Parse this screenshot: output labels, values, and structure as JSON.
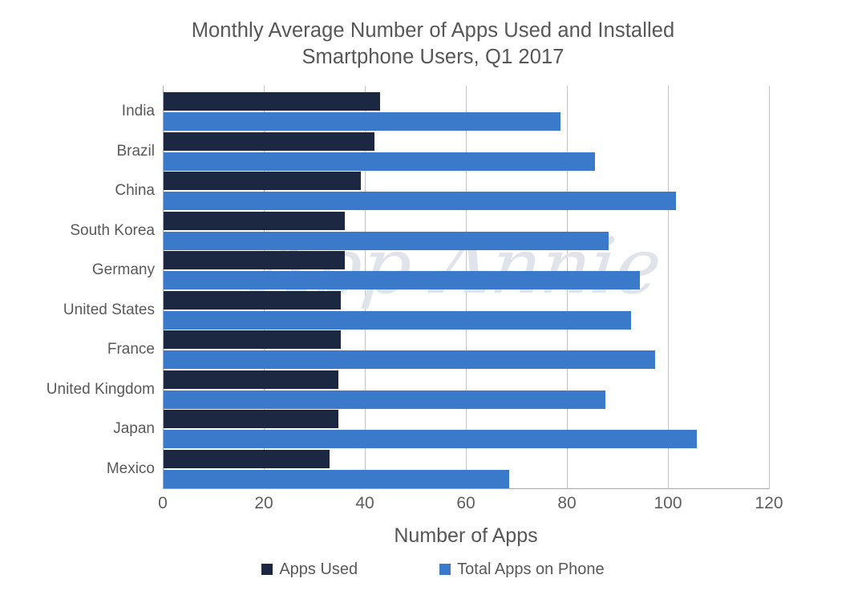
{
  "chart_data": {
    "type": "bar",
    "orientation": "horizontal",
    "title": "Monthly Average Number of Apps Used and Installed",
    "subtitle": "Smartphone Users, Q1 2017",
    "xlabel": "Number of Apps",
    "ylabel": "",
    "xlim": [
      0,
      120
    ],
    "xticks": [
      0,
      20,
      40,
      60,
      80,
      100,
      120
    ],
    "xtick_labels": [
      "0",
      "20",
      "40",
      "60",
      "80",
      "100",
      "120"
    ],
    "grid": "vertical",
    "legend_position": "bottom",
    "watermark": "App Annie",
    "categories": [
      "India",
      "Brazil",
      "China",
      "South Korea",
      "Germany",
      "United States",
      "France",
      "United Kingdom",
      "Japan",
      "Mexico"
    ],
    "series": [
      {
        "name": "Apps Used",
        "color": "#1c2841",
        "values": [
          42.8,
          41.8,
          39.0,
          35.9,
          35.9,
          35.1,
          35.1,
          34.6,
          34.6,
          32.9
        ]
      },
      {
        "name": "Total Apps on Phone",
        "color": "#3b79cb",
        "values": [
          78.5,
          85.4,
          101.5,
          88.1,
          94.3,
          92.5,
          97.3,
          87.5,
          105.6,
          68.4
        ]
      }
    ]
  }
}
